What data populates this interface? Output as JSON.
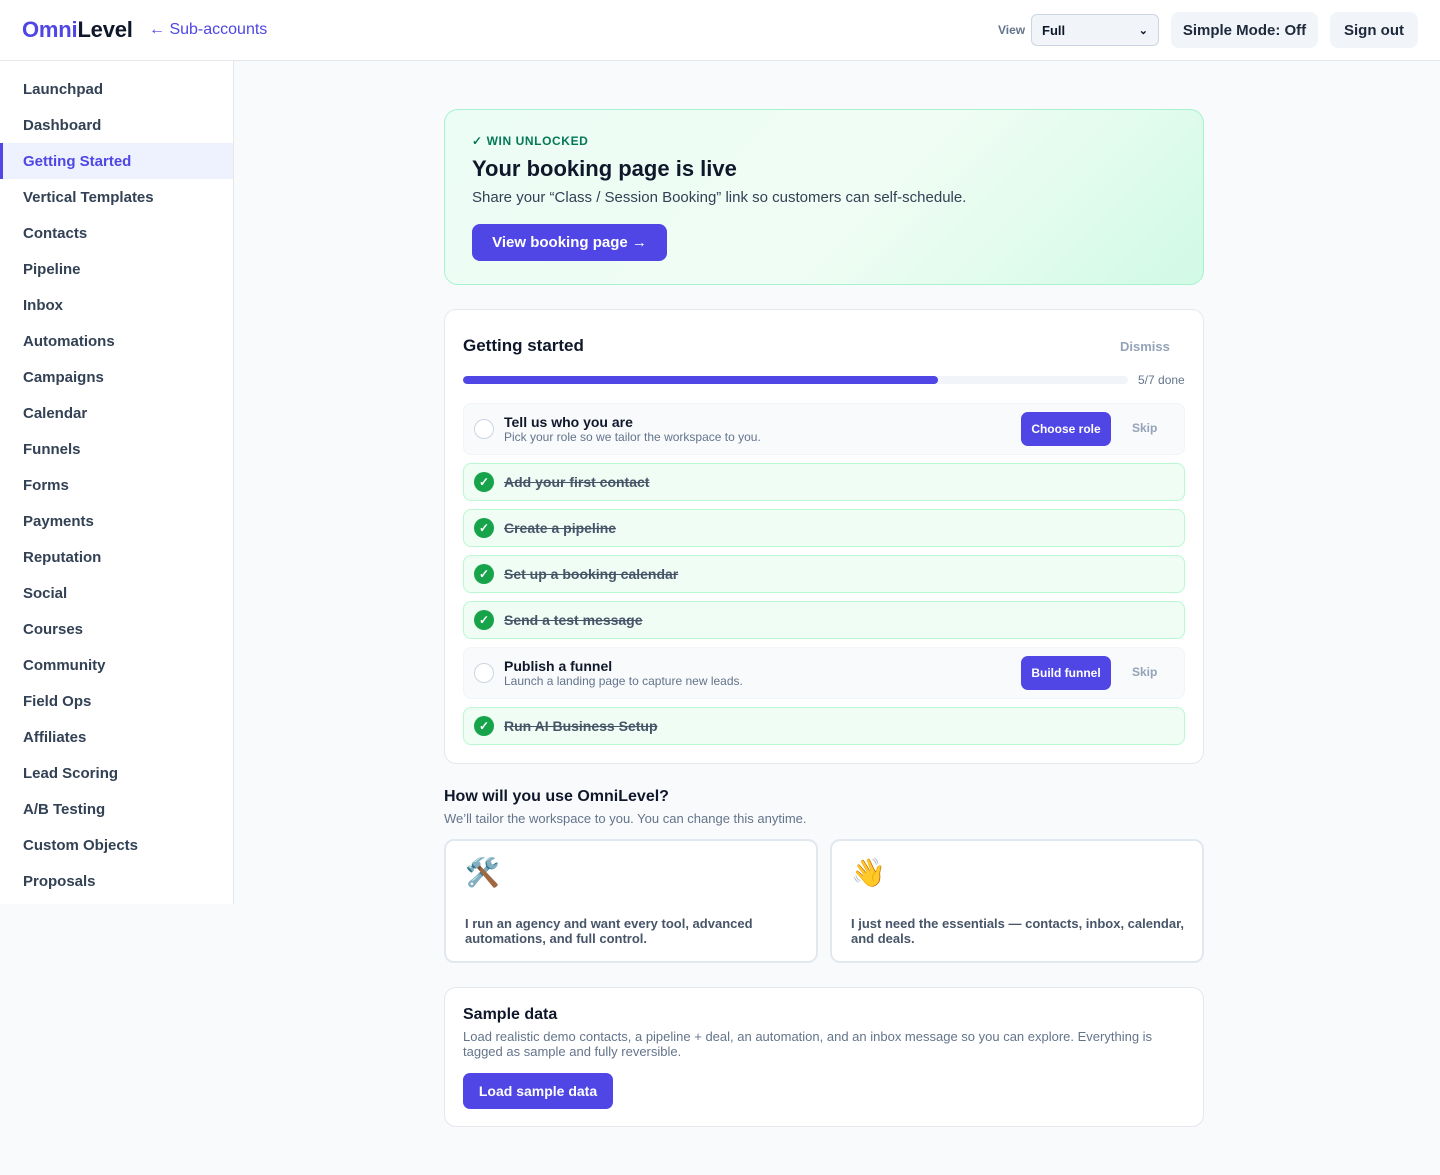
{
  "header": {
    "brand_part1": "Omni",
    "brand_part2": "Level",
    "back_link": "← Sub-accounts",
    "view_label": "View",
    "view_selected": "Full",
    "simple_mode_button": "Simple Mode: Off",
    "sign_out_button": "Sign out"
  },
  "sidebar": {
    "items": [
      {
        "label": "Launchpad",
        "active": false
      },
      {
        "label": "Dashboard",
        "active": false
      },
      {
        "label": "Getting Started",
        "active": true
      },
      {
        "label": "Vertical Templates",
        "active": false
      },
      {
        "label": "Contacts",
        "active": false
      },
      {
        "label": "Pipeline",
        "active": false
      },
      {
        "label": "Inbox",
        "active": false
      },
      {
        "label": "Automations",
        "active": false
      },
      {
        "label": "Campaigns",
        "active": false
      },
      {
        "label": "Calendar",
        "active": false
      },
      {
        "label": "Funnels",
        "active": false
      },
      {
        "label": "Forms",
        "active": false
      },
      {
        "label": "Payments",
        "active": false
      },
      {
        "label": "Reputation",
        "active": false
      },
      {
        "label": "Social",
        "active": false
      },
      {
        "label": "Courses",
        "active": false
      },
      {
        "label": "Community",
        "active": false
      },
      {
        "label": "Field Ops",
        "active": false
      },
      {
        "label": "Affiliates",
        "active": false
      },
      {
        "label": "Lead Scoring",
        "active": false
      },
      {
        "label": "A/B Testing",
        "active": false
      },
      {
        "label": "Custom Objects",
        "active": false
      },
      {
        "label": "Proposals",
        "active": false
      }
    ]
  },
  "win_banner": {
    "tag": "✓ WIN UNLOCKED",
    "title": "Your booking page is live",
    "subtitle": "Share your “Class / Session Booking” link so customers can self-schedule.",
    "button": "View booking page →"
  },
  "getting_started": {
    "title": "Getting started",
    "dismiss": "Dismiss",
    "progress_fraction": 0.714,
    "progress_label": "5/7 done",
    "tasks": [
      {
        "title": "Tell us who you are",
        "description": "Pick your role so we tailor the workspace to you.",
        "done": false,
        "action": "Choose role",
        "skip": "Skip"
      },
      {
        "title": "Add your first contact",
        "done": true
      },
      {
        "title": "Create a pipeline",
        "done": true
      },
      {
        "title": "Set up a booking calendar",
        "done": true
      },
      {
        "title": "Send a test message",
        "done": true
      },
      {
        "title": "Publish a funnel",
        "description": "Launch a landing page to capture new leads.",
        "done": false,
        "action": "Build funnel",
        "skip": "Skip"
      },
      {
        "title": "Run AI Business Setup",
        "done": true
      }
    ]
  },
  "usage": {
    "title": "How will you use OmniLevel?",
    "subtitle": "We’ll tailor the workspace to you. You can change this anytime.",
    "options": [
      {
        "icon": "🛠️",
        "icon_name": "tools-icon",
        "text": "I run an agency and want every tool, advanced automations, and full control."
      },
      {
        "icon": "👋",
        "icon_name": "waving-hand-icon",
        "text": "I just need the essentials — contacts, inbox, calendar, and deals."
      }
    ]
  },
  "sample_data": {
    "title": "Sample data",
    "description": "Load realistic demo contacts, a pipeline + deal, an automation, and an inbox message so you can explore. Everything is tagged as sample and fully reversible.",
    "button": "Load sample data"
  },
  "colors": {
    "accent": "#4f46e5",
    "success": "#16a34a",
    "success_bg": "#f0fdf4"
  }
}
